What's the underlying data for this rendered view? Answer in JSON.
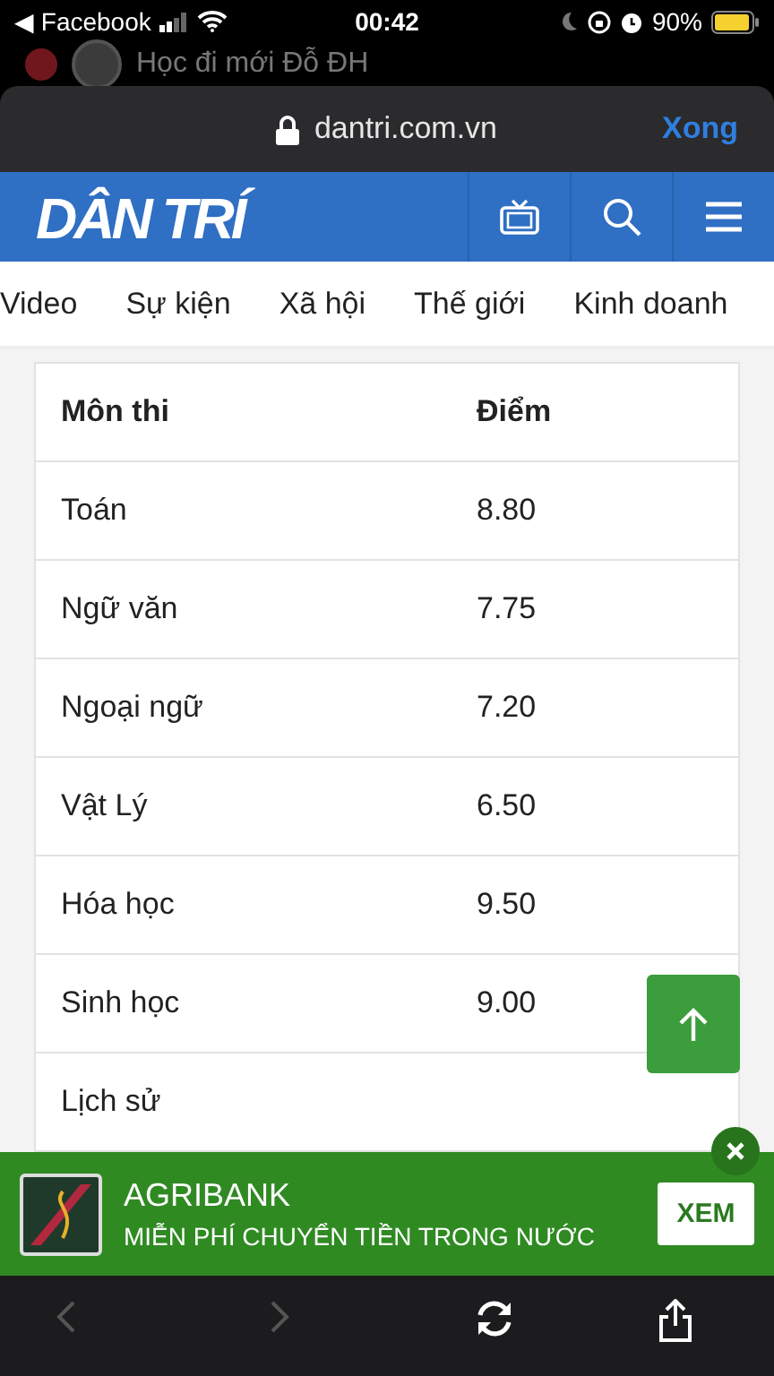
{
  "status_bar": {
    "back_label": "◀ Facebook",
    "time": "00:42",
    "battery": "90%"
  },
  "background_app": {
    "title": "Học đi mới Đỗ ĐH"
  },
  "browser": {
    "url": "dantri.com.vn",
    "done": "Xong"
  },
  "site": {
    "logo": "DÂN TRÍ"
  },
  "nav": [
    {
      "label": "Video"
    },
    {
      "label": "Sự kiện"
    },
    {
      "label": "Xã hội"
    },
    {
      "label": "Thế giới"
    },
    {
      "label": "Kinh doanh"
    }
  ],
  "table": {
    "columns": [
      "Môn thi",
      "Điểm"
    ],
    "rows": [
      {
        "subject": "Toán",
        "score": "8.80"
      },
      {
        "subject": "Ngữ văn",
        "score": "7.75"
      },
      {
        "subject": "Ngoại ngữ",
        "score": "7.20"
      },
      {
        "subject": "Vật Lý",
        "score": "6.50"
      },
      {
        "subject": "Hóa học",
        "score": "9.50"
      },
      {
        "subject": "Sinh học",
        "score": "9.00"
      },
      {
        "subject": "Lịch sử"
      }
    ]
  },
  "ad": {
    "brand": "AGRIBANK",
    "text": "MIỄN PHÍ CHUYỂN TIỀN TRONG NƯỚC",
    "button": "XEM"
  }
}
